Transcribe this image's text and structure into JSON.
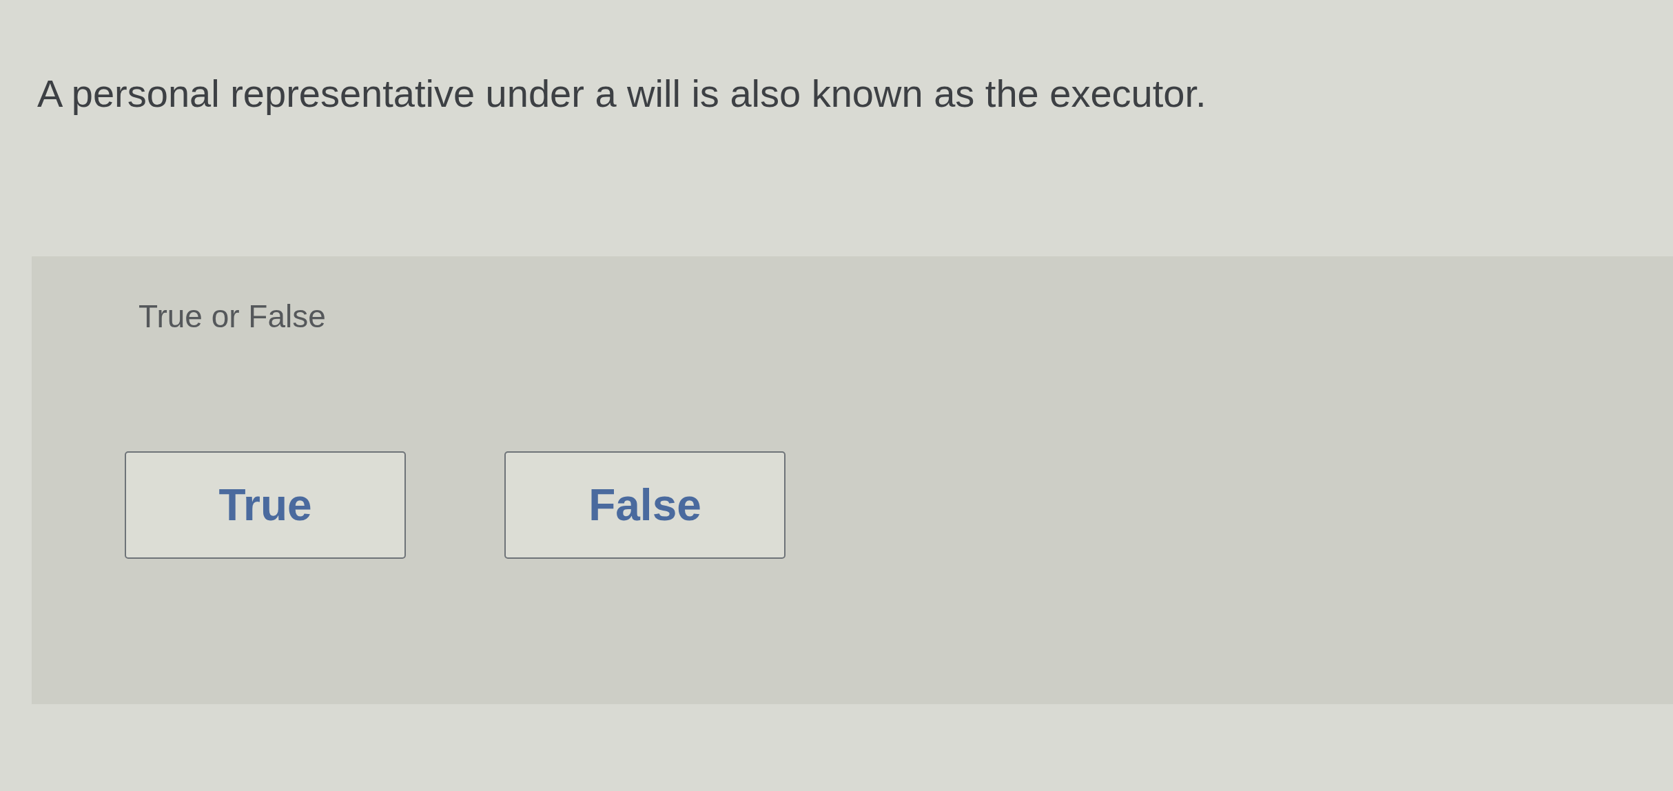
{
  "question": {
    "text": "A personal representative under a will is also known as the executor."
  },
  "answer_panel": {
    "prompt": "True or False",
    "options": [
      {
        "label": "True",
        "selected": false
      },
      {
        "label": "False",
        "selected": false
      }
    ]
  }
}
